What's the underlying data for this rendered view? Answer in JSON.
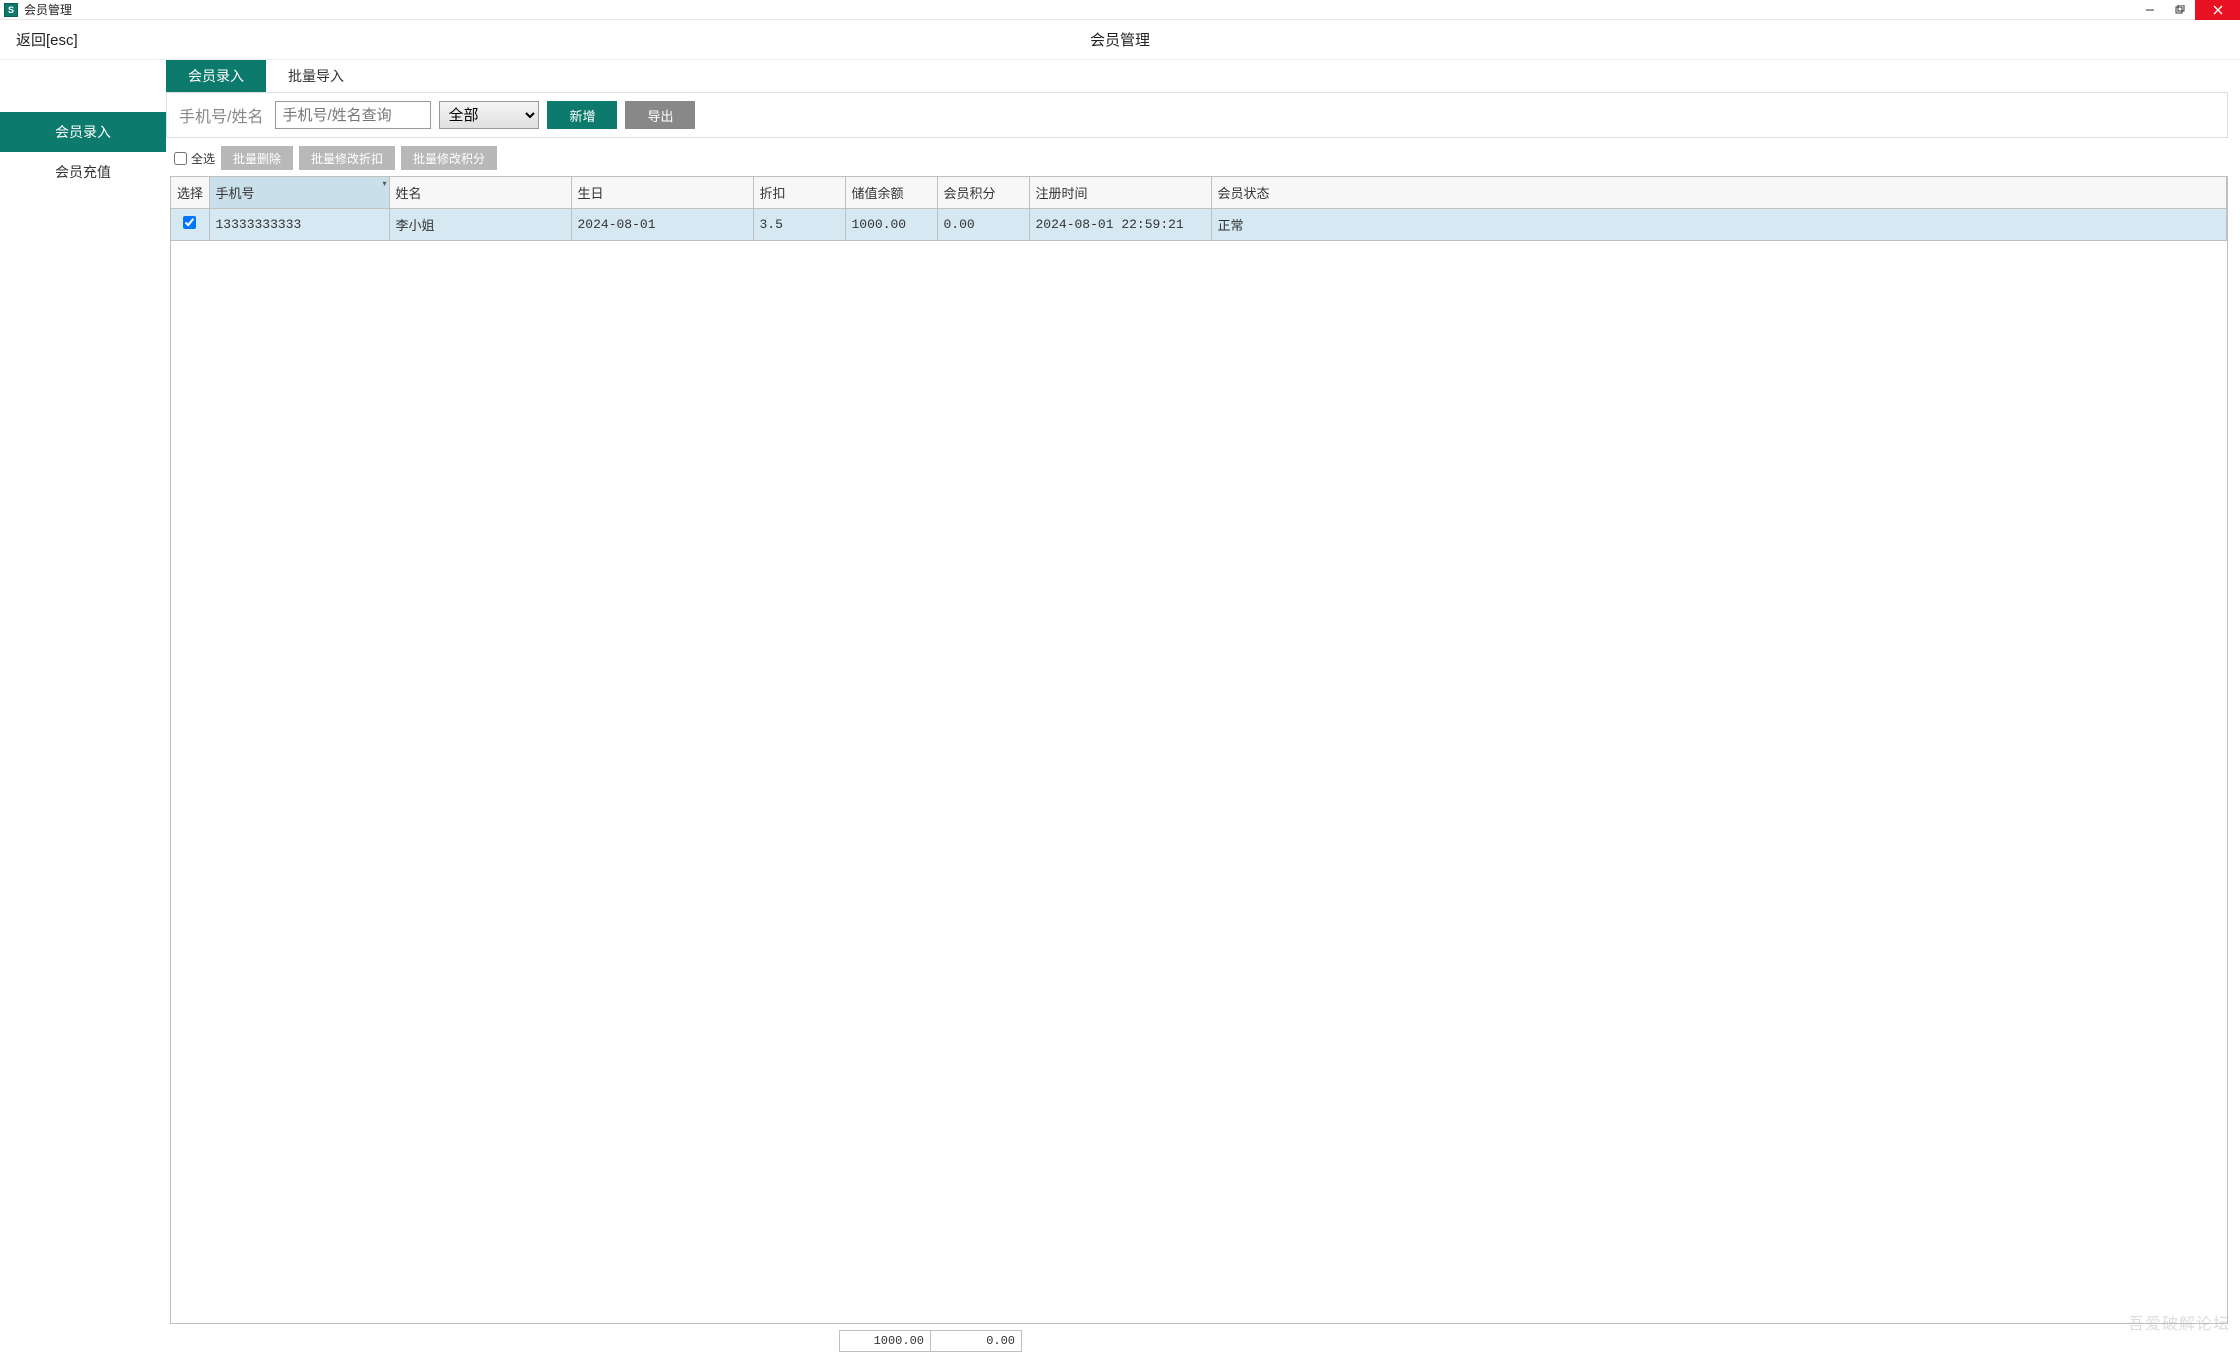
{
  "window": {
    "title": "会员管理"
  },
  "topbar": {
    "back_label": "返回[esc]",
    "page_title": "会员管理"
  },
  "sidebar": {
    "items": [
      {
        "label": "会员录入",
        "active": true
      },
      {
        "label": "会员充值",
        "active": false
      }
    ]
  },
  "tabs": [
    {
      "label": "会员录入",
      "active": true
    },
    {
      "label": "批量导入",
      "active": false
    }
  ],
  "filter": {
    "label": "手机号/姓名",
    "search_placeholder": "手机号/姓名查询",
    "status_selected": "全部",
    "add_label": "新增",
    "export_label": "导出"
  },
  "bulk": {
    "select_all_label": "全选",
    "btn_delete": "批量删除",
    "btn_discount": "批量修改折扣",
    "btn_points": "批量修改积分"
  },
  "table": {
    "headers": {
      "select": "选择",
      "phone": "手机号",
      "name": "姓名",
      "birthday": "生日",
      "discount": "折扣",
      "balance": "储值余额",
      "points": "会员积分",
      "register_time": "注册时间",
      "status": "会员状态"
    },
    "rows": [
      {
        "checked": true,
        "phone": "13333333333",
        "name": "李小姐",
        "birthday": "2024-08-01",
        "discount": "3.5",
        "balance": "1000.00",
        "points": "0.00",
        "register_time": "2024-08-01 22:59:21",
        "status": "正常"
      }
    ],
    "totals": {
      "balance": "1000.00",
      "points": "0.00"
    }
  },
  "watermark": "吾爱破解论坛"
}
